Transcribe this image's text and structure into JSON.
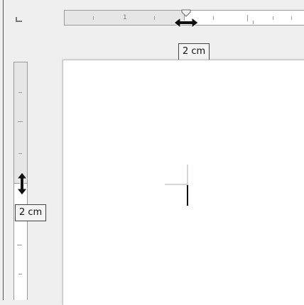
{
  "tooltips": {
    "horizontal": "2 cm",
    "vertical": "2 cm"
  },
  "rulers": {
    "horizontal_number": "1",
    "horizontal_margin_value_cm": 2,
    "vertical_margin_value_cm": 2
  },
  "icons": {
    "tab_stop": "tab-stop-left-icon",
    "h_resize": "horizontal-resize-arrow-icon",
    "v_resize": "vertical-resize-arrow-icon",
    "indent": "indent-marker-icon"
  },
  "colors": {
    "background": "#efefef",
    "ruler_margin": "#e6e6e6",
    "page": "#ffffff",
    "tooltip_bg": "#f4f4f4"
  }
}
